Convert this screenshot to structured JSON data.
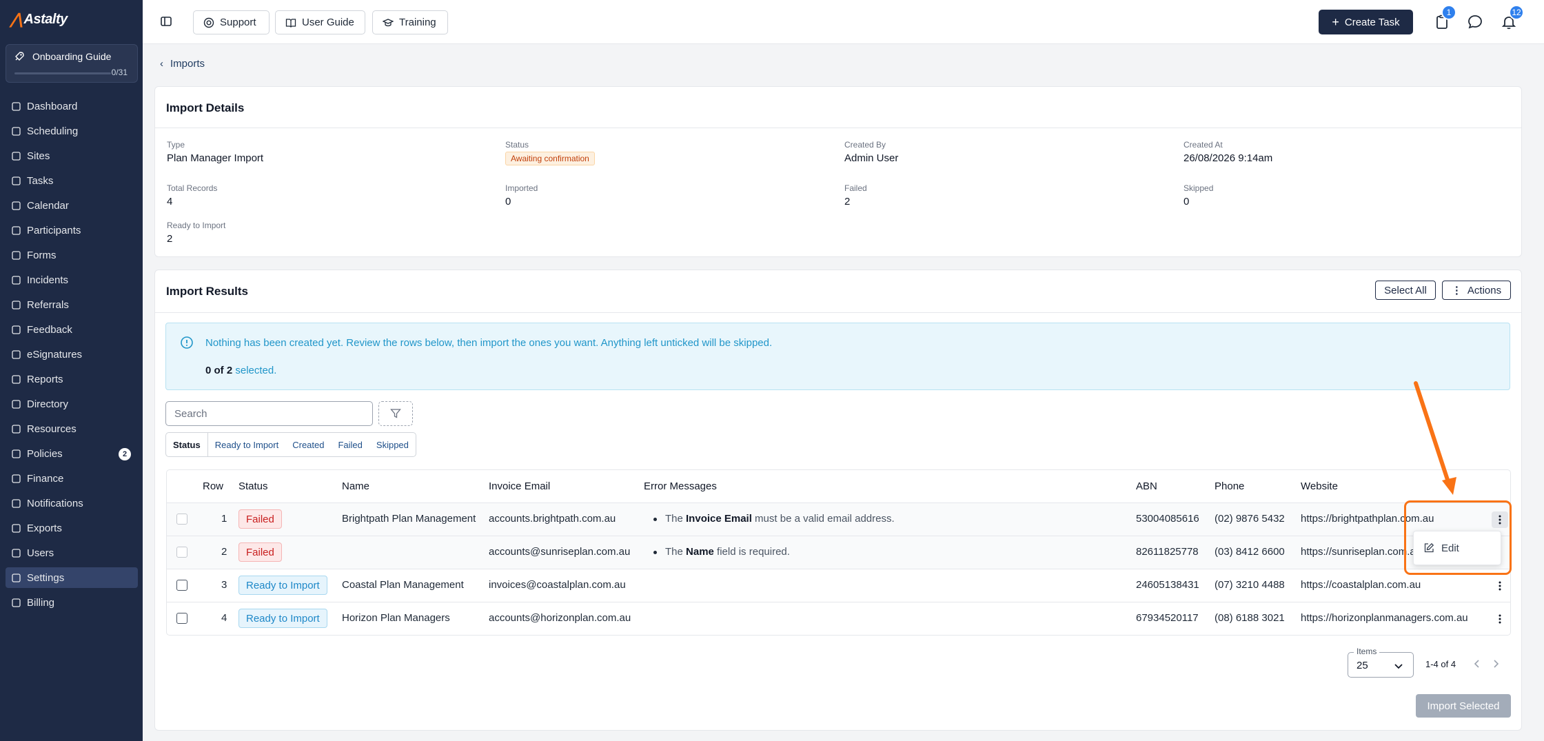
{
  "app": {
    "logo_text": "Astalty"
  },
  "onboarding": {
    "title": "Onboarding Guide",
    "progress_text": "0/31",
    "progress": 0
  },
  "sidebar": {
    "items": [
      {
        "label": "Dashboard",
        "icon": "dashboard-icon"
      },
      {
        "label": "Scheduling",
        "icon": "scheduling-icon"
      },
      {
        "label": "Sites",
        "icon": "sites-icon"
      },
      {
        "label": "Tasks",
        "icon": "tasks-icon"
      },
      {
        "label": "Calendar",
        "icon": "calendar-icon"
      },
      {
        "label": "Participants",
        "icon": "participants-icon"
      },
      {
        "label": "Forms",
        "icon": "forms-icon"
      },
      {
        "label": "Incidents",
        "icon": "incidents-icon"
      },
      {
        "label": "Referrals",
        "icon": "referrals-icon"
      },
      {
        "label": "Feedback",
        "icon": "feedback-icon"
      },
      {
        "label": "eSignatures",
        "icon": "esignatures-icon"
      },
      {
        "label": "Reports",
        "icon": "reports-icon"
      },
      {
        "label": "Directory",
        "icon": "directory-icon"
      },
      {
        "label": "Resources",
        "icon": "resources-icon"
      },
      {
        "label": "Policies",
        "icon": "policies-icon",
        "badge": "2"
      },
      {
        "label": "Finance",
        "icon": "finance-icon"
      },
      {
        "label": "Notifications",
        "icon": "notifications-icon"
      },
      {
        "label": "Exports",
        "icon": "exports-icon"
      },
      {
        "label": "Users",
        "icon": "users-icon"
      },
      {
        "label": "Settings",
        "icon": "settings-icon",
        "active": true
      },
      {
        "label": "Billing",
        "icon": "billing-icon"
      }
    ]
  },
  "topbar": {
    "support_label": "Support",
    "guide_label": "User Guide",
    "training_label": "Training",
    "create_task_label": "Create Task",
    "clipboard_badge": "1",
    "bell_badge": "12"
  },
  "breadcrumb": {
    "back_label": "Imports"
  },
  "import_details": {
    "title": "Import Details",
    "type_label": "Type",
    "type_value": "Plan Manager Import",
    "status_label": "Status",
    "status_value": "Awaiting confirmation",
    "created_by_label": "Created By",
    "created_by_value": "Admin User",
    "created_at_label": "Created At",
    "created_at_value": "26/08/2026 9:14am",
    "total_label": "Total Records",
    "total_value": "4",
    "imported_label": "Imported",
    "imported_value": "0",
    "failed_label": "Failed",
    "failed_value": "2",
    "skipped_label": "Skipped",
    "skipped_value": "0",
    "ready_label": "Ready to Import",
    "ready_value": "2"
  },
  "import_results": {
    "title": "Import Results",
    "select_all_label": "Select All",
    "actions_label": "Actions",
    "alert_message": "Nothing has been created yet. Review the rows below, then import the ones you want. Anything left unticked will be skipped.",
    "selected_count": "0 of 2",
    "selected_suffix": "selected.",
    "search_placeholder": "Search",
    "filters": [
      "Status",
      "Ready to Import",
      "Created",
      "Failed",
      "Skipped"
    ],
    "columns": [
      "Row",
      "Status",
      "Name",
      "Invoice Email",
      "Error Messages",
      "ABN",
      "Phone",
      "Website"
    ],
    "rows": [
      {
        "row": "1",
        "status": "Failed",
        "name": "Brightpath Plan Management",
        "email": "accounts.brightpath.com.au",
        "err_pre": "The ",
        "err_bold": "Invoice Email",
        "err_post": " must be a valid email address.",
        "abn": "53004085616",
        "phone": "(02) 9876 5432",
        "website": "https://brightpathplan.com.au"
      },
      {
        "row": "2",
        "status": "Failed",
        "name": "",
        "email": "accounts@sunriseplan.com.au",
        "err_pre": "The ",
        "err_bold": "Name",
        "err_post": " field is required.",
        "abn": "82611825778",
        "phone": "(03) 8412 6600",
        "website": "https://sunriseplan.com.au"
      },
      {
        "row": "3",
        "status": "Ready to Import",
        "name": "Coastal Plan Management",
        "email": "invoices@coastalplan.com.au",
        "abn": "24605138431",
        "phone": "(07) 3210 4488",
        "website": "https://coastalplan.com.au"
      },
      {
        "row": "4",
        "status": "Ready to Import",
        "name": "Horizon Plan Managers",
        "email": "accounts@horizonplan.com.au",
        "abn": "67934520117",
        "phone": "(08) 6188 3021",
        "website": "https://horizonplanmanagers.com.au"
      }
    ],
    "row_menu": {
      "edit_label": "Edit"
    },
    "items_label": "Items",
    "items_value": "25",
    "page_range": "1-4 of 4",
    "import_selected_label": "Import Selected"
  },
  "colors": {
    "sidebar_bg": "#1e2a45",
    "accent": "#1e2a45",
    "annotation": "#f97316",
    "badge": "#2f80ed"
  }
}
